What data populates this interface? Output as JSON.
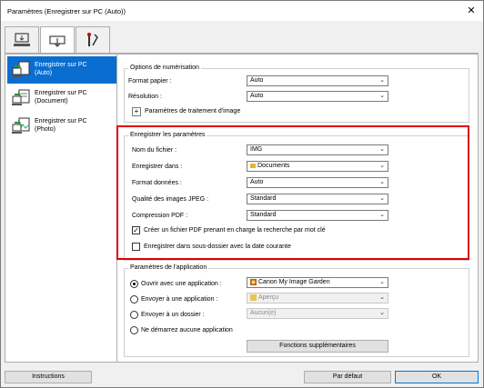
{
  "window": {
    "title": "Paramètres (Enregistrer sur PC (Auto))",
    "close_glyph": "✕"
  },
  "tabs": [
    {
      "name": "scan-from-computer",
      "icon": "computer-scan-icon",
      "active": false
    },
    {
      "name": "scan-from-operation-panel",
      "icon": "scanner-icon",
      "active": true
    },
    {
      "name": "general-settings",
      "icon": "tools-icon",
      "active": false
    }
  ],
  "sidebar": {
    "items": [
      {
        "label_line1": "Enregistrer sur PC",
        "label_line2": "(Auto)",
        "selected": true
      },
      {
        "label_line1": "Enregistrer sur PC",
        "label_line2": "(Document)",
        "selected": false
      },
      {
        "label_line1": "Enregistrer sur PC",
        "label_line2": "(Photo)",
        "selected": false
      }
    ]
  },
  "scan_options": {
    "title": "Options de numérisation",
    "paper_size": {
      "label": "Format papier :",
      "value": "Auto"
    },
    "resolution": {
      "label": "Résolution :",
      "value": "Auto"
    },
    "image_processing": {
      "label": "Paramètres de traitement d'image",
      "expander": "+"
    }
  },
  "save_settings": {
    "title": "Enregistrer les paramètres",
    "file_name": {
      "label": "Nom du fichier :",
      "value": "IMG"
    },
    "save_in": {
      "label": "Enregistrer dans :",
      "value": "Documents"
    },
    "data_format": {
      "label": "Format données :",
      "value": "Auto"
    },
    "jpeg_quality": {
      "label": "Qualité des images JPEG :",
      "value": "Standard"
    },
    "pdf_compression": {
      "label": "Compression PDF :",
      "value": "Standard"
    },
    "searchable_pdf": {
      "label": "Créer un fichier PDF prenant en charge la recherche par mot clé",
      "checked": true
    },
    "subfolder": {
      "label": "Enregistrer dans sous-dossier avec la date courante",
      "checked": false
    }
  },
  "app_settings": {
    "title": "Paramètres de l'application",
    "open_with": {
      "label": "Ouvrir avec une application :",
      "value": "Canon My Image Garden",
      "selected": true
    },
    "send_to_app": {
      "label": "Envoyer à une application :",
      "value": "Aperçu",
      "selected": false
    },
    "send_to_folder": {
      "label": "Envoyer à un dossier :",
      "value": "Aucun(e)",
      "selected": false
    },
    "no_app": {
      "label": "Ne démarrez aucune application",
      "selected": false
    },
    "more_functions": "Fonctions supplémentaires"
  },
  "footer": {
    "instructions": "Instructions",
    "defaults": "Par défaut",
    "ok": "OK"
  },
  "glyphs": {
    "arrow": "⌄",
    "check": "✓"
  }
}
